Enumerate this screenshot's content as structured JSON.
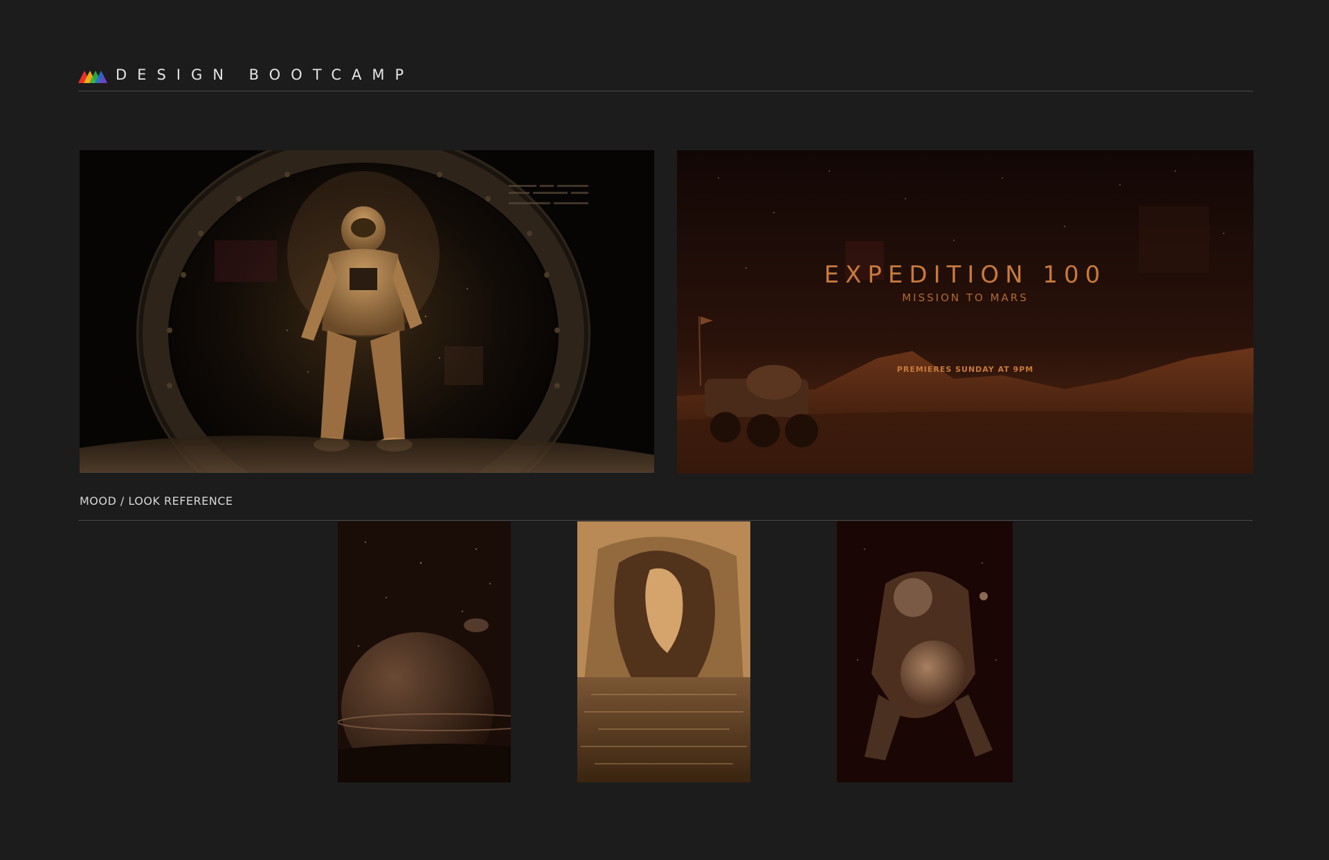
{
  "header": {
    "brand": "DESIGN BOOTCAMP",
    "logo_colors": [
      "#e8322c",
      "#f2b515",
      "#2fb34a",
      "#2a6fd6",
      "#7b3fbf"
    ]
  },
  "frames": {
    "astronaut_doorway": {
      "description_icon": "astronaut-portal-image"
    },
    "expedition": {
      "title": "EXPEDITION 100",
      "subtitle": "MISSION TO MARS",
      "premiere": "PREMIERES SUNDAY AT 9PM"
    }
  },
  "section": {
    "label": "MOOD / LOOK REFERENCE"
  },
  "references": [
    {
      "icon": "ringed-planet-image"
    },
    {
      "icon": "ice-cave-image"
    },
    {
      "icon": "astronaut-earth-image"
    }
  ],
  "colors": {
    "background": "#1c1c1c",
    "accent": "#c87a3c",
    "divider": "#4a4a4a"
  }
}
